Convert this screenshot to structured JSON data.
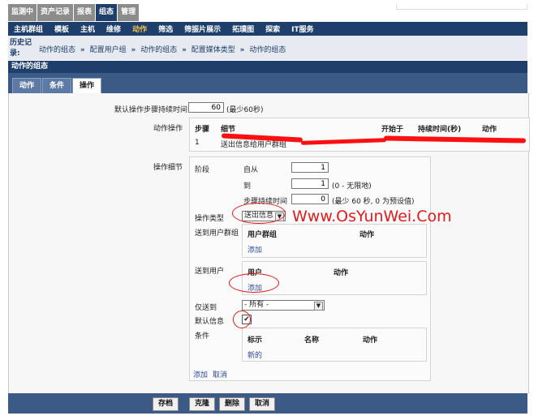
{
  "top_tabs": [
    "监测中",
    "资产记录",
    "报表",
    "组态",
    "管理"
  ],
  "top_tab_active": 3,
  "subnav": [
    "主机群组",
    "模板",
    "主机",
    "维修",
    "动作",
    "筛选",
    "筛振片展示",
    "拓璞图",
    "探索",
    "IT服务"
  ],
  "subnav_active": 4,
  "history": {
    "label": "历史记录:",
    "crumbs": [
      "动作的组态",
      "配置用户组",
      "动作的组态",
      "配置媒体类型",
      "动作的组态"
    ],
    "separator": "»"
  },
  "section_title": "动作的组态",
  "tabs": [
    "动作",
    "条件",
    "操作"
  ],
  "tab_active": 2,
  "form": {
    "default_duration_label": "默认操作步骤持续时间",
    "default_duration_value": "60",
    "default_duration_note": "(最少60秒)",
    "operations_label": "动作操作",
    "operations_table": {
      "headers": [
        "步骤",
        "细节",
        "开始于",
        "持续时间(秒)",
        "动作"
      ],
      "row": {
        "step": "1",
        "detail": "送出信息给用户群组"
      }
    },
    "op_details_label": "操作细节",
    "steps_label": "阶段",
    "from_label": "自从",
    "from_value": "1",
    "to_label": "到",
    "to_value": "1",
    "to_note": "(0 - 无限地)",
    "step_duration_label": "步骤持续时间",
    "step_duration_value": "0",
    "step_duration_note": "(最少 60 秒, 0 为预设值)",
    "op_type_label": "操作类型",
    "op_type_value": "送出信息",
    "send_groups_label": "送到用户群组",
    "send_groups_headers": [
      "用户群组",
      "动作"
    ],
    "send_groups_add": "添加",
    "send_users_label": "送到用户",
    "send_users_headers": [
      "用户",
      "动作"
    ],
    "send_users_add": "添加",
    "only_send_label": "仅送到",
    "only_send_value": "- 所有 -",
    "default_msg_label": "默认信息",
    "default_msg_checked": "✔",
    "conditions_label": "条件",
    "conditions_headers": [
      "标示",
      "名称",
      "动作"
    ],
    "conditions_new": "新的",
    "add_link": "添加",
    "cancel_link": "取消"
  },
  "watermark": "Www.OsYunWei.Com",
  "footer_buttons": [
    "存档",
    "克隆",
    "删除",
    "取消"
  ],
  "colors": {
    "nav": "#1e3f6c",
    "accent": "#f3c04b",
    "annotation": "#e31a1a"
  }
}
